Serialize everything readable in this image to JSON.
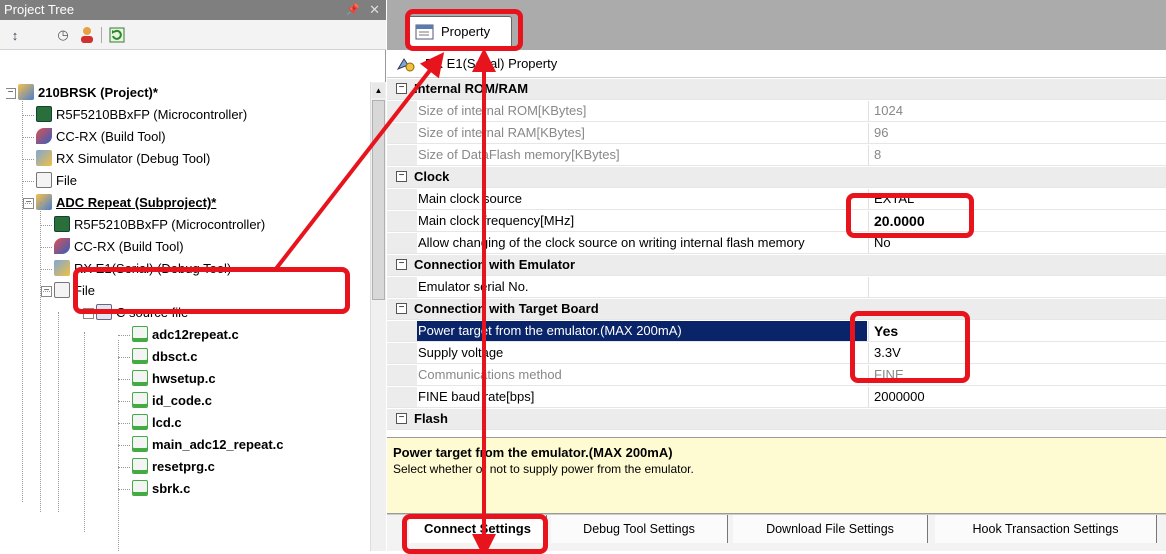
{
  "project_tree": {
    "title": "Project Tree",
    "pin_icon": "pin-icon",
    "close_icon": "close-icon",
    "toolbar": [
      "sort-icon",
      "clock-icon",
      "user-icon",
      "refresh-icon"
    ],
    "nodes": [
      {
        "label": "210BRSK (Project)*",
        "bold": true,
        "icon": "project-icon"
      },
      {
        "label": "R5F5210BBxFP (Microcontroller)",
        "icon": "chip-icon"
      },
      {
        "label": "CC-RX (Build Tool)",
        "icon": "build-tool-icon"
      },
      {
        "label": "RX Simulator (Debug Tool)",
        "icon": "debug-tool-icon"
      },
      {
        "label": "File",
        "icon": "file-icon"
      },
      {
        "label": "ADC Repeat (Subproject)*",
        "bold": true,
        "icon": "project-icon"
      },
      {
        "label": "R5F5210BBxFP (Microcontroller)",
        "icon": "chip-icon"
      },
      {
        "label": "CC-RX (Build Tool)",
        "icon": "build-tool-icon"
      },
      {
        "label": "RX E1(Serial) (Debug Tool)",
        "icon": "debug-tool-icon"
      },
      {
        "label": "File",
        "icon": "file-icon"
      },
      {
        "label": "C source file",
        "icon": "folder-icon"
      },
      {
        "label": "adc12repeat.c",
        "bold": true,
        "icon": "c-file-icon"
      },
      {
        "label": "dbsct.c",
        "bold": true,
        "icon": "c-file-icon"
      },
      {
        "label": "hwsetup.c",
        "bold": true,
        "icon": "c-file-icon"
      },
      {
        "label": "id_code.c",
        "bold": true,
        "icon": "c-file-icon"
      },
      {
        "label": "lcd.c",
        "bold": true,
        "icon": "c-file-icon"
      },
      {
        "label": "main_adc12_repeat.c",
        "bold": true,
        "icon": "c-file-icon"
      },
      {
        "label": "resetprg.c",
        "bold": true,
        "icon": "c-file-icon"
      },
      {
        "label": "sbrk.c",
        "bold": true,
        "icon": "c-file-icon"
      }
    ]
  },
  "property_panel": {
    "tab_label": "Property",
    "header": "RX E1(Serial) Property",
    "rows": [
      {
        "type": "cat",
        "name": "Internal ROM/RAM"
      },
      {
        "type": "prop",
        "name": "Size of internal ROM[KBytes]",
        "value": "1024",
        "disabled": true
      },
      {
        "type": "prop",
        "name": "Size of internal RAM[KBytes]",
        "value": "96",
        "disabled": true
      },
      {
        "type": "prop",
        "name": "Size of DataFlash memory[KBytes]",
        "value": "8",
        "disabled": true
      },
      {
        "type": "cat",
        "name": "Clock"
      },
      {
        "type": "prop",
        "name": "Main clock source",
        "value": "EXTAL"
      },
      {
        "type": "prop",
        "name": "Main clock frequency[MHz]",
        "value": "20.0000",
        "bold": true
      },
      {
        "type": "prop",
        "name": "Allow changing of the clock source on writing internal flash memory",
        "value": "No"
      },
      {
        "type": "cat",
        "name": "Connection with Emulator"
      },
      {
        "type": "prop",
        "name": "Emulator serial No.",
        "value": ""
      },
      {
        "type": "cat",
        "name": "Connection with Target Board"
      },
      {
        "type": "prop",
        "name": "Power target from the emulator.(MAX 200mA)",
        "value": "Yes",
        "bold": true,
        "selected": true
      },
      {
        "type": "prop",
        "name": "Supply voltage",
        "value": "3.3V"
      },
      {
        "type": "prop",
        "name": "Communications method",
        "value": "FINE",
        "disabled": true
      },
      {
        "type": "prop",
        "name": "FINE baud rate[bps]",
        "value": "2000000"
      },
      {
        "type": "cat",
        "name": "Flash"
      }
    ],
    "description": {
      "title": "Power target from the emulator.(MAX 200mA)",
      "text": "Select whether or not to supply power from the emulator."
    },
    "bottom_tabs": [
      "Connect Settings",
      "Debug Tool Settings",
      "Download File Settings",
      "Hook Transaction Settings"
    ],
    "active_tab": "Connect Settings"
  },
  "annotation_color": "#e8141d"
}
